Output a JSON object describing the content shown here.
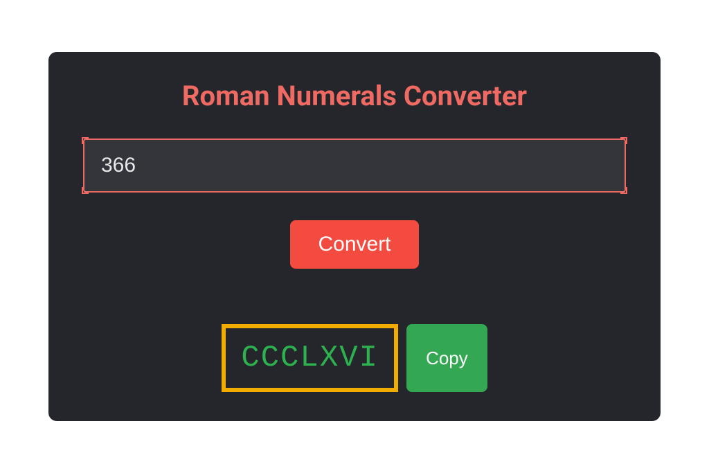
{
  "title": "Roman Numerals Converter",
  "input": {
    "value": "366"
  },
  "convert_label": "Convert",
  "result": "CCCLXVI",
  "copy_label": "Copy"
}
